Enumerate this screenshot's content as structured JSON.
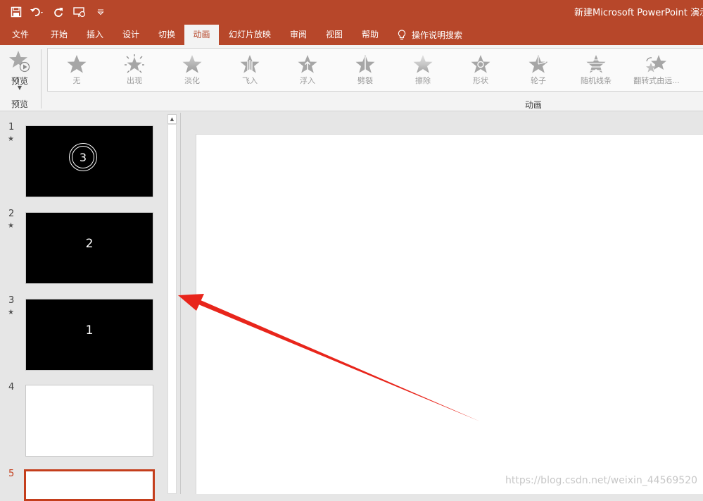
{
  "title_bar": {
    "doc_title": "新建Microsoft PowerPoint 演示文",
    "quick_access": [
      "save-icon",
      "undo-icon",
      "redo-icon",
      "present-from-start-icon",
      "customize-qat-icon"
    ]
  },
  "tabs": [
    {
      "label": "文件",
      "active": false
    },
    {
      "label": "开始",
      "active": false
    },
    {
      "label": "插入",
      "active": false
    },
    {
      "label": "设计",
      "active": false
    },
    {
      "label": "切换",
      "active": false
    },
    {
      "label": "动画",
      "active": true
    },
    {
      "label": "幻灯片放映",
      "active": false
    },
    {
      "label": "审阅",
      "active": false
    },
    {
      "label": "视图",
      "active": false
    },
    {
      "label": "帮助",
      "active": false
    }
  ],
  "tell_me": {
    "label": "操作说明搜索"
  },
  "ribbon": {
    "preview": {
      "button_label": "预览",
      "group_label": "预览"
    },
    "animation_group_label": "动画",
    "animations": [
      {
        "label": "无",
        "icon": "star-none-icon"
      },
      {
        "label": "出现",
        "icon": "star-appear-icon"
      },
      {
        "label": "淡化",
        "icon": "star-fade-icon"
      },
      {
        "label": "飞入",
        "icon": "star-fly-in-icon"
      },
      {
        "label": "浮入",
        "icon": "star-float-in-icon"
      },
      {
        "label": "劈裂",
        "icon": "star-split-icon"
      },
      {
        "label": "擦除",
        "icon": "star-wipe-icon"
      },
      {
        "label": "形状",
        "icon": "star-shape-icon"
      },
      {
        "label": "轮子",
        "icon": "star-wheel-icon"
      },
      {
        "label": "随机线条",
        "icon": "star-random-bars-icon"
      },
      {
        "label": "翻转式由远...",
        "icon": "star-grow-turn-icon"
      }
    ]
  },
  "slides": [
    {
      "number": "1",
      "has_animation": true,
      "star": "★",
      "background": "black",
      "text": "3",
      "circle": true
    },
    {
      "number": "2",
      "has_animation": true,
      "star": "★",
      "background": "black",
      "text": "2",
      "circle": false
    },
    {
      "number": "3",
      "has_animation": true,
      "star": "★",
      "background": "black",
      "text": "1",
      "circle": false
    },
    {
      "number": "4",
      "has_animation": false,
      "background": "white",
      "text": ""
    },
    {
      "number": "5",
      "has_animation": false,
      "background": "white",
      "text": "",
      "selected": true
    }
  ],
  "watermark": "https://blog.csdn.net/weixin_44569520",
  "colors": {
    "accent": "#b7472a",
    "selected_border": "#c43e1c",
    "annotation_arrow": "#e8251b"
  }
}
